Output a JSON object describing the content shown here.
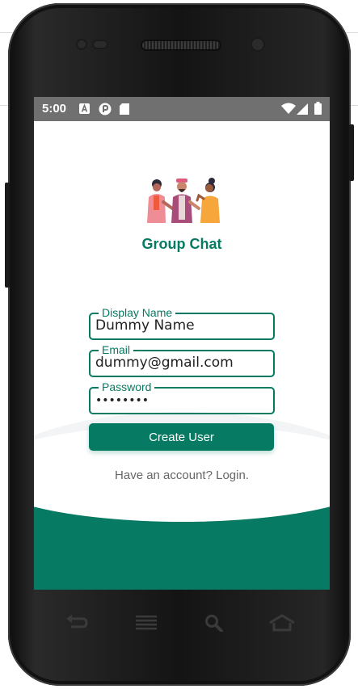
{
  "status_bar": {
    "time": "5:00"
  },
  "app": {
    "title": "Group Chat"
  },
  "form": {
    "display_name": {
      "label": "Display Name",
      "value": "Dummy Name"
    },
    "email": {
      "label": "Email",
      "value": "dummy@gmail.com"
    },
    "password": {
      "label": "Password",
      "value": "••••••••"
    },
    "submit_label": "Create User",
    "login_link": "Have an account? Login."
  },
  "colors": {
    "accent": "#067a62",
    "status_bar": "#707070",
    "device": "#141414"
  },
  "icons": {
    "nav_keys": [
      "back-icon",
      "menu-icon",
      "search-icon",
      "home-icon"
    ],
    "status": [
      "notification-a-icon",
      "notification-app-icon",
      "sd-card-icon",
      "wifi-icon",
      "signal-icon",
      "battery-icon"
    ]
  }
}
